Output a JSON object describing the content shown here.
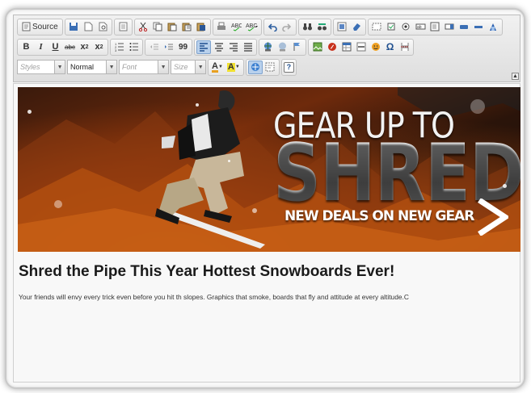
{
  "toolbar": {
    "source_label": "Source",
    "bold_label": "B",
    "italic_label": "I",
    "underline_label": "U",
    "strike_label": "abc",
    "subscript_label": "x",
    "subscript_sub": "2",
    "superscript_label": "x",
    "superscript_sup": "2",
    "blockquote_label": "99",
    "omega_label": "Ω",
    "styles_placeholder": "Styles",
    "format_value": "Normal",
    "font_placeholder": "Font",
    "size_placeholder": "Size",
    "text_color_label": "A",
    "bg_color_label": "A",
    "help_label": "?",
    "collapse_label": "▲"
  },
  "banner": {
    "line1": "GEAR UP TO",
    "line2": "SHRED",
    "line3": "NEW DEALS ON NEW GEAR"
  },
  "content": {
    "heading": "Shred the Pipe This Year Hottest Snowboards Ever!",
    "paragraph": "Your friends will envy every trick even before you hit th slopes.  Graphics that smoke, boards that fly and attitude at every altitude.C"
  },
  "colors": {
    "accent_orange": "#c85a12",
    "toolbar_bg": "#e6e6e6",
    "editor_bg": "#f8f8f8",
    "active_button": "#b8d0ec"
  }
}
